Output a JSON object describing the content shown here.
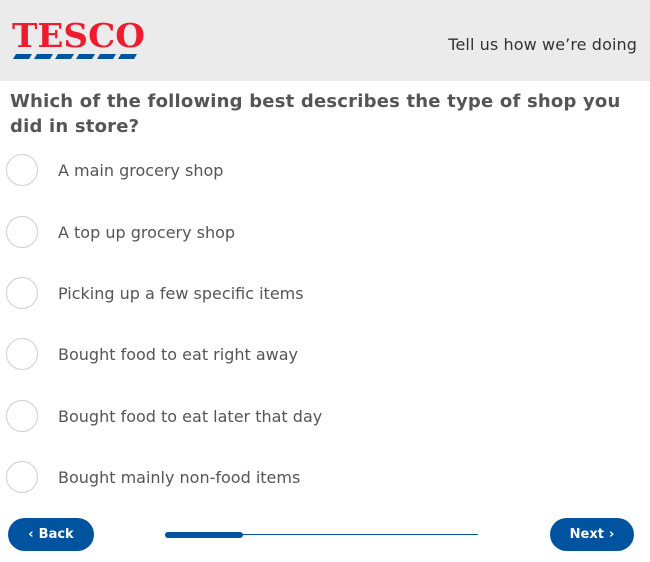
{
  "header": {
    "logo_text": "TESCO",
    "tagline": "Tell us how we’re doing"
  },
  "question": {
    "text": "Which of the following best describes the type of shop you did in store?"
  },
  "options": [
    {
      "label": "A main grocery shop",
      "selected": false
    },
    {
      "label": "A top up grocery shop",
      "selected": false
    },
    {
      "label": "Picking up a few specific items",
      "selected": false
    },
    {
      "label": "Bought food to eat right away",
      "selected": false
    },
    {
      "label": "Bought food to eat later that day",
      "selected": false
    },
    {
      "label": "Bought mainly non-food items",
      "selected": false
    }
  ],
  "footer": {
    "back_label": "Back",
    "next_label": "Next",
    "progress_fraction": 0.25
  },
  "colors": {
    "brand_blue": "#00539f",
    "brand_red": "#ee1c2e",
    "header_bg": "#ebebeb"
  },
  "icons": {
    "back": "chevron-left-icon",
    "next": "chevron-right-icon"
  }
}
